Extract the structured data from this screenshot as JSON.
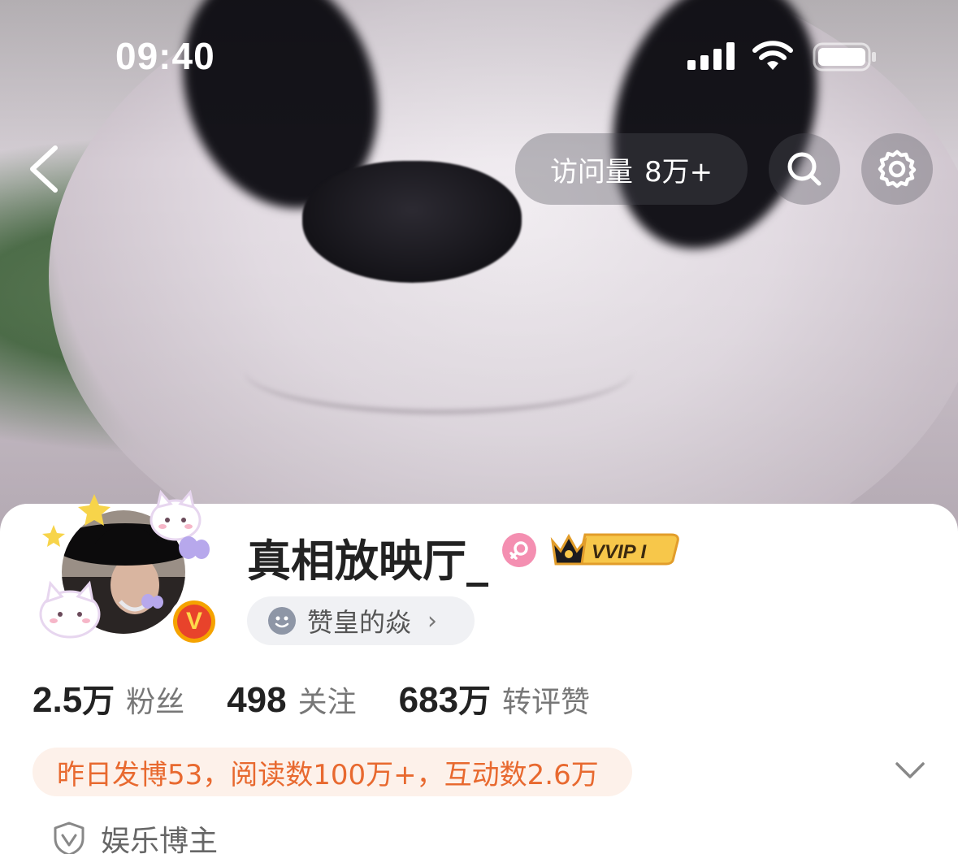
{
  "status_bar": {
    "time": "09:40"
  },
  "nav": {
    "visits_label": "访问量",
    "visits_value": "8万+",
    "back_icon": "chevron-left-icon",
    "search_icon": "search-icon",
    "settings_icon": "gear-icon"
  },
  "profile": {
    "username": "真相放映厅_",
    "gender_icon": "female-icon",
    "vip_badge": "VVIP I",
    "verified_badge": "V",
    "tag": "赞皇的焱",
    "tag_chevron": "›"
  },
  "stats": [
    {
      "num": "2.5",
      "unit": "万",
      "label": "粉丝"
    },
    {
      "num": "498",
      "unit": "",
      "label": "关注"
    },
    {
      "num": "683",
      "unit": "万",
      "label": "转评赞"
    }
  ],
  "daily_summary": "昨日发博53，阅读数100万+，互动数2.6万",
  "category": "娱乐博主",
  "colors": {
    "accent_orange": "#e8692f",
    "summary_bg": "#fdf1ea",
    "pill_bg": "#f0f1f4",
    "gender_pink": "#f48fb1"
  }
}
